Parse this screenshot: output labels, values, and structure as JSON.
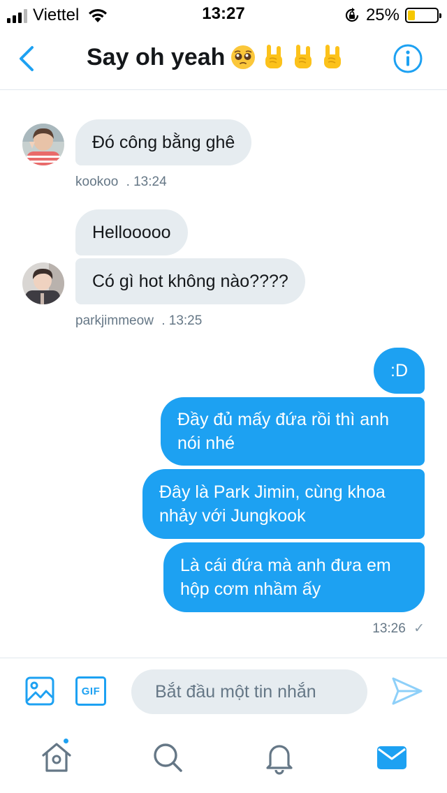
{
  "status_bar": {
    "carrier": "Viettel",
    "time": "13:27",
    "battery_percent": "25%",
    "battery_level": 0.25,
    "icons": [
      "signal-icon",
      "wifi-icon",
      "orientation-lock-icon",
      "battery-icon"
    ]
  },
  "header": {
    "title": "Say oh yeah",
    "title_emojis": [
      "pleading-face-emoji",
      "sign-of-the-horns-emoji",
      "sign-of-the-horns-emoji",
      "sign-of-the-horns-emoji"
    ],
    "back_icon": "chevron-left-icon",
    "info_icon": "info-icon"
  },
  "conversation": {
    "groups": [
      {
        "direction": "incoming",
        "sender": "kookoo",
        "time": ". 13:24",
        "messages": [
          "Đó công bằng ghê"
        ]
      },
      {
        "direction": "incoming",
        "sender": "parkjimmeow",
        "time": ". 13:25",
        "messages": [
          "Hellooooo",
          "Có gì hot không nào????"
        ]
      },
      {
        "direction": "outgoing",
        "time": "13:26",
        "status": "✓",
        "messages": [
          ":D",
          "Đầy đủ mấy đứa rồi thì anh nói nhé",
          "Đây là Park Jimin, cùng khoa nhảy với Jungkook",
          "Là cái đứa mà anh đưa em hộp cơm nhầm ấy"
        ]
      }
    ]
  },
  "composer": {
    "placeholder": "Bắt đầu một tin nhắn",
    "gif_label": "GIF",
    "icons": [
      "image-icon",
      "gif-icon",
      "send-icon"
    ]
  },
  "tab_bar": {
    "tabs": [
      "home-icon",
      "search-icon",
      "notifications-icon",
      "messages-icon"
    ],
    "active_tab": "messages-icon",
    "accent_color": "#1da1f2",
    "inactive_color": "#657786"
  },
  "colors": {
    "accent": "#1da1f2",
    "incoming_bubble": "#e6ecf0",
    "outgoing_bubble": "#1da1f2",
    "meta_text": "#657786"
  }
}
